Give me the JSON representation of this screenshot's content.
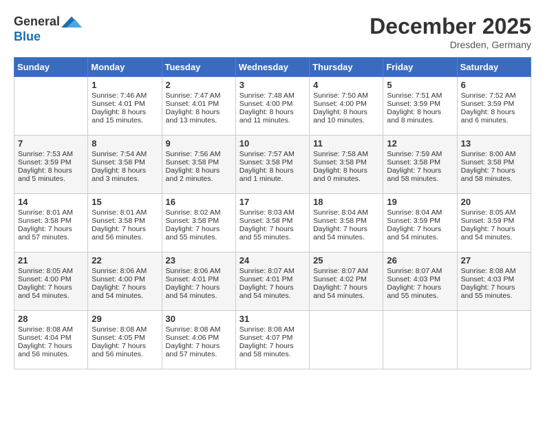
{
  "header": {
    "logo_general": "General",
    "logo_blue": "Blue",
    "month_year": "December 2025",
    "location": "Dresden, Germany"
  },
  "days_of_week": [
    "Sunday",
    "Monday",
    "Tuesday",
    "Wednesday",
    "Thursday",
    "Friday",
    "Saturday"
  ],
  "weeks": [
    [
      {
        "day": "",
        "sunrise": "",
        "sunset": "",
        "daylight": ""
      },
      {
        "day": "1",
        "sunrise": "7:46 AM",
        "sunset": "4:01 PM",
        "daylight": "8 hours and 15 minutes."
      },
      {
        "day": "2",
        "sunrise": "7:47 AM",
        "sunset": "4:01 PM",
        "daylight": "8 hours and 13 minutes."
      },
      {
        "day": "3",
        "sunrise": "7:48 AM",
        "sunset": "4:00 PM",
        "daylight": "8 hours and 11 minutes."
      },
      {
        "day": "4",
        "sunrise": "7:50 AM",
        "sunset": "4:00 PM",
        "daylight": "8 hours and 10 minutes."
      },
      {
        "day": "5",
        "sunrise": "7:51 AM",
        "sunset": "3:59 PM",
        "daylight": "8 hours and 8 minutes."
      },
      {
        "day": "6",
        "sunrise": "7:52 AM",
        "sunset": "3:59 PM",
        "daylight": "8 hours and 6 minutes."
      }
    ],
    [
      {
        "day": "7",
        "sunrise": "7:53 AM",
        "sunset": "3:59 PM",
        "daylight": "8 hours and 5 minutes."
      },
      {
        "day": "8",
        "sunrise": "7:54 AM",
        "sunset": "3:58 PM",
        "daylight": "8 hours and 3 minutes."
      },
      {
        "day": "9",
        "sunrise": "7:56 AM",
        "sunset": "3:58 PM",
        "daylight": "8 hours and 2 minutes."
      },
      {
        "day": "10",
        "sunrise": "7:57 AM",
        "sunset": "3:58 PM",
        "daylight": "8 hours and 1 minute."
      },
      {
        "day": "11",
        "sunrise": "7:58 AM",
        "sunset": "3:58 PM",
        "daylight": "8 hours and 0 minutes."
      },
      {
        "day": "12",
        "sunrise": "7:59 AM",
        "sunset": "3:58 PM",
        "daylight": "7 hours and 58 minutes."
      },
      {
        "day": "13",
        "sunrise": "8:00 AM",
        "sunset": "3:58 PM",
        "daylight": "7 hours and 58 minutes."
      }
    ],
    [
      {
        "day": "14",
        "sunrise": "8:01 AM",
        "sunset": "3:58 PM",
        "daylight": "7 hours and 57 minutes."
      },
      {
        "day": "15",
        "sunrise": "8:01 AM",
        "sunset": "3:58 PM",
        "daylight": "7 hours and 56 minutes."
      },
      {
        "day": "16",
        "sunrise": "8:02 AM",
        "sunset": "3:58 PM",
        "daylight": "7 hours and 55 minutes."
      },
      {
        "day": "17",
        "sunrise": "8:03 AM",
        "sunset": "3:58 PM",
        "daylight": "7 hours and 55 minutes."
      },
      {
        "day": "18",
        "sunrise": "8:04 AM",
        "sunset": "3:58 PM",
        "daylight": "7 hours and 54 minutes."
      },
      {
        "day": "19",
        "sunrise": "8:04 AM",
        "sunset": "3:59 PM",
        "daylight": "7 hours and 54 minutes."
      },
      {
        "day": "20",
        "sunrise": "8:05 AM",
        "sunset": "3:59 PM",
        "daylight": "7 hours and 54 minutes."
      }
    ],
    [
      {
        "day": "21",
        "sunrise": "8:05 AM",
        "sunset": "4:00 PM",
        "daylight": "7 hours and 54 minutes."
      },
      {
        "day": "22",
        "sunrise": "8:06 AM",
        "sunset": "4:00 PM",
        "daylight": "7 hours and 54 minutes."
      },
      {
        "day": "23",
        "sunrise": "8:06 AM",
        "sunset": "4:01 PM",
        "daylight": "7 hours and 54 minutes."
      },
      {
        "day": "24",
        "sunrise": "8:07 AM",
        "sunset": "4:01 PM",
        "daylight": "7 hours and 54 minutes."
      },
      {
        "day": "25",
        "sunrise": "8:07 AM",
        "sunset": "4:02 PM",
        "daylight": "7 hours and 54 minutes."
      },
      {
        "day": "26",
        "sunrise": "8:07 AM",
        "sunset": "4:03 PM",
        "daylight": "7 hours and 55 minutes."
      },
      {
        "day": "27",
        "sunrise": "8:08 AM",
        "sunset": "4:03 PM",
        "daylight": "7 hours and 55 minutes."
      }
    ],
    [
      {
        "day": "28",
        "sunrise": "8:08 AM",
        "sunset": "4:04 PM",
        "daylight": "7 hours and 56 minutes."
      },
      {
        "day": "29",
        "sunrise": "8:08 AM",
        "sunset": "4:05 PM",
        "daylight": "7 hours and 56 minutes."
      },
      {
        "day": "30",
        "sunrise": "8:08 AM",
        "sunset": "4:06 PM",
        "daylight": "7 hours and 57 minutes."
      },
      {
        "day": "31",
        "sunrise": "8:08 AM",
        "sunset": "4:07 PM",
        "daylight": "7 hours and 58 minutes."
      },
      {
        "day": "",
        "sunrise": "",
        "sunset": "",
        "daylight": ""
      },
      {
        "day": "",
        "sunrise": "",
        "sunset": "",
        "daylight": ""
      },
      {
        "day": "",
        "sunrise": "",
        "sunset": "",
        "daylight": ""
      }
    ]
  ],
  "labels": {
    "sunrise_prefix": "Sunrise: ",
    "sunset_prefix": "Sunset: ",
    "daylight_prefix": "Daylight: "
  }
}
